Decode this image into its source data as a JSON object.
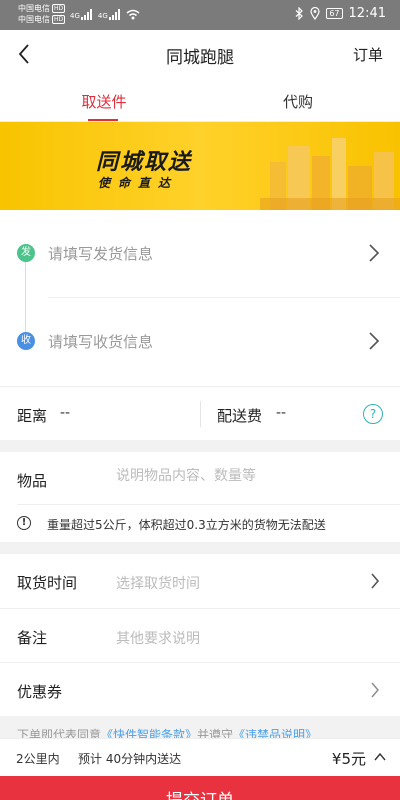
{
  "status_bar": {
    "carrier_1": "中国电信",
    "carrier_2": "中国电信",
    "hd_badge": "HD",
    "network_1": "4G",
    "network_2": "4G",
    "battery": "67",
    "time": "12:41"
  },
  "nav": {
    "title": "同城跑腿",
    "orders_label": "订单"
  },
  "tabs": [
    {
      "label": "取送件",
      "active": true
    },
    {
      "label": "代购",
      "active": false
    }
  ],
  "banner": {
    "title": "同城取送",
    "subtitle": "使命直达"
  },
  "address": {
    "send_badge": "发",
    "send_placeholder": "请填写发货信息",
    "recv_badge": "收",
    "recv_placeholder": "请填写收货信息"
  },
  "fee": {
    "distance_label": "距离",
    "distance_value": "--",
    "delivery_label": "配送费",
    "delivery_value": "--",
    "help_glyph": "?"
  },
  "goods": {
    "label": "物品",
    "placeholder": "说明物品内容、数量等",
    "warning_glyph": "!",
    "warning_text": "重量超过5公斤，体积超过0.3立方米的货物无法配送"
  },
  "extras": {
    "pickup_label": "取货时间",
    "pickup_placeholder": "选择取货时间",
    "notes_label": "备注",
    "notes_placeholder": "其他要求说明",
    "coupon_label": "优惠券"
  },
  "terms": {
    "prefix": "下单即代表同意",
    "link_1": "《快件智能条款》",
    "middle": "并遵守",
    "link_2": "《违禁品说明》"
  },
  "bottom": {
    "distance": "2公里内",
    "eta": "预计 40分钟内送达",
    "price": "¥5元"
  },
  "submit_label": "提交订单",
  "colors": {
    "accent": "#e02e3c",
    "send": "#4cc38a",
    "recv": "#4a90e2",
    "banner": "#f8c400",
    "help": "#33b3b3",
    "link": "#4aa0e6"
  }
}
